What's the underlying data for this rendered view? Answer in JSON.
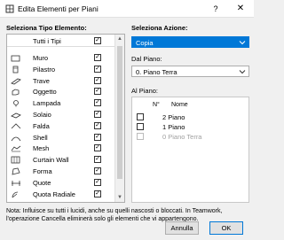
{
  "window": {
    "title": "Edita Elementi per Piani",
    "help_glyph": "?",
    "close_glyph": "✕"
  },
  "left": {
    "heading": "Seleziona Tipo Elemento:",
    "all_label": "Tutti i Tipi",
    "types": [
      {
        "label": "Muro",
        "icon": "wall-icon",
        "checked": true
      },
      {
        "label": "Pilastro",
        "icon": "column-icon",
        "checked": true
      },
      {
        "label": "Trave",
        "icon": "beam-icon",
        "checked": true
      },
      {
        "label": "Oggetto",
        "icon": "object-icon",
        "checked": true
      },
      {
        "label": "Lampada",
        "icon": "lamp-icon",
        "checked": true
      },
      {
        "label": "Solaio",
        "icon": "slab-icon",
        "checked": true
      },
      {
        "label": "Falda",
        "icon": "roof-icon",
        "checked": true
      },
      {
        "label": "Shell",
        "icon": "shell-icon",
        "checked": true
      },
      {
        "label": "Mesh",
        "icon": "mesh-icon",
        "checked": true
      },
      {
        "label": "Curtain Wall",
        "icon": "curtain-wall-icon",
        "checked": true
      },
      {
        "label": "Forma",
        "icon": "morph-icon",
        "checked": true
      },
      {
        "label": "Quote",
        "icon": "dimension-icon",
        "checked": true
      },
      {
        "label": "Quota Radiale",
        "icon": "radial-dimension-icon",
        "checked": true
      }
    ]
  },
  "right": {
    "action_heading": "Seleziona Azione:",
    "action_value": "Copia",
    "from_label": "Dal Piano:",
    "from_value": "0. Piano Terra",
    "to_label": "Al Piano:",
    "col_no": "N°",
    "col_name": "Nome",
    "floors": [
      {
        "num": "2",
        "name": "Piano",
        "enabled": true
      },
      {
        "num": "1",
        "name": "Piano",
        "enabled": true
      },
      {
        "num": "0",
        "name": "Piano Terra",
        "enabled": false
      }
    ]
  },
  "note": "Nota: Influisce su tutti i lucidi, anche su quelli nascosti o bloccati. In Teamwork, l'operazione Cancella eliminerà solo gli elementi che vi appartengono.",
  "buttons": {
    "cancel": "Annulla",
    "ok": "OK"
  },
  "colors": {
    "accent": "#0078d7"
  }
}
